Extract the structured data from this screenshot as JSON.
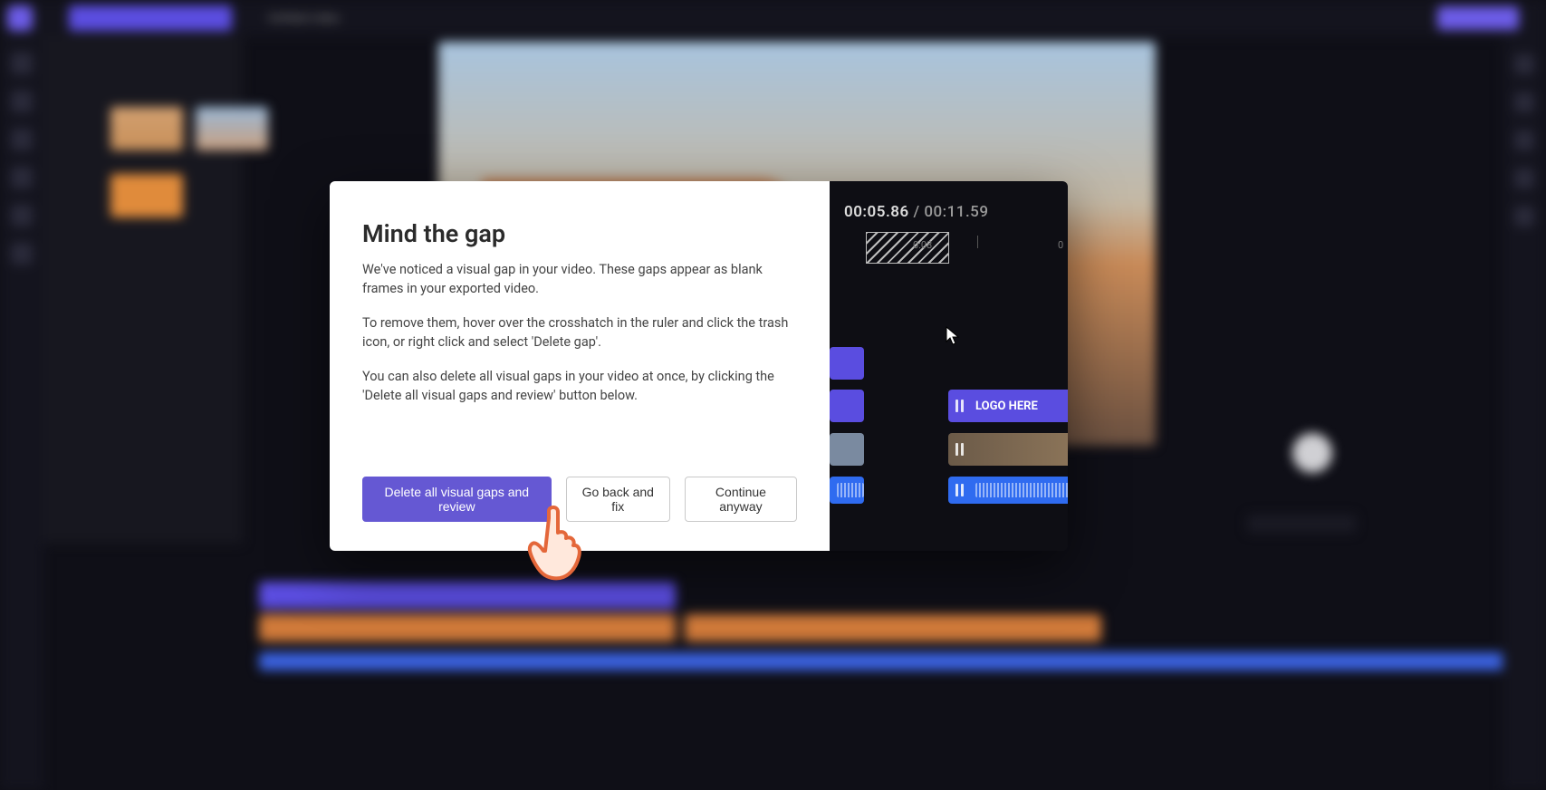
{
  "top_bar": {
    "project_name": "Untitled video"
  },
  "dialog": {
    "title": "Mind the gap",
    "para1": "We've noticed a visual gap in your video. These gaps appear as blank frames in your exported video.",
    "para2": "To remove them, hover over the crosshatch in the ruler and click the trash icon, or right click and select 'Delete gap'.",
    "para3": "You can also delete all visual gaps in your video at once, by clicking the 'Delete all visual gaps and review' button below.",
    "buttons": {
      "primary": "Delete all visual gaps and review",
      "back": "Go back and fix",
      "continue": "Continue anyway"
    }
  },
  "preview_panel": {
    "current_time": "00:05.86",
    "separator": " / ",
    "total_time": "00:11.59",
    "ruler": {
      "tick_a": "0:08",
      "tick_b": "0"
    },
    "logo_clip_label": "LOGO HERE"
  }
}
